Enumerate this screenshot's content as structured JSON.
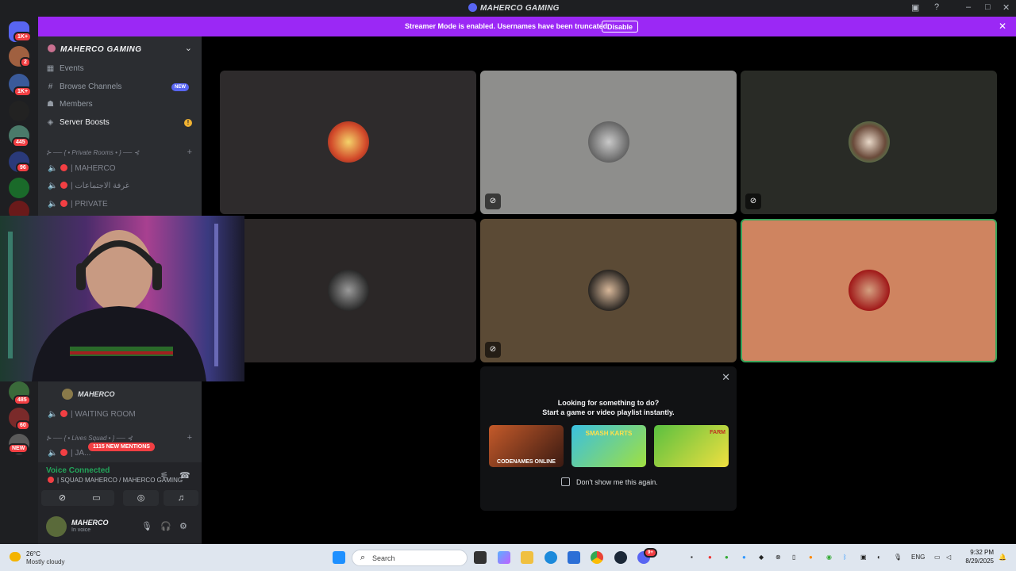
{
  "window": {
    "title": "MAHERCO GAMING"
  },
  "banner": {
    "message": "Streamer Mode is enabled. Usernames have been truncated.",
    "button": "Disable",
    "bg": "#9b28f5"
  },
  "rail": {
    "badges": [
      "1K+",
      "2",
      "1K+",
      "445",
      "96",
      "485",
      "60",
      "NEW"
    ]
  },
  "sidebar": {
    "server_name": "MAHERCO GAMING",
    "nav": [
      {
        "label": "Events",
        "icon": "calendar-icon"
      },
      {
        "label": "Browse Channels",
        "icon": "browse-channels-icon",
        "badge": "NEW"
      },
      {
        "label": "Members",
        "icon": "members-icon"
      },
      {
        "label": "Server Boosts",
        "icon": "boost-icon"
      }
    ],
    "categories": {
      "private": "⊱ ── { • Private Rooms • } ── ⊰",
      "lives": "⊱ ── { • Lives Squad • } ── ⊰"
    },
    "voice_channels": [
      "| MAHERCO",
      "| غرفة الاجتماعات",
      "| PRIVATE",
      "| WAITING ROOM",
      "| JA..."
    ],
    "member": "MAHERCO",
    "mentions": "1115 NEW MENTIONS"
  },
  "voice": {
    "status": "Voice Connected",
    "channel": "| SQUAD MAHERCO / MAHERCO GAMING",
    "user": "MAHERCO",
    "user_status": "In voice"
  },
  "popup": {
    "line1": "Looking for something to do?",
    "line2": "Start a game or video playlist instantly.",
    "games": [
      "CODENAMES ONLINE",
      "SMASH KARTS",
      "FARM"
    ],
    "checkbox_label": "Don't show me this again."
  },
  "taskbar": {
    "temp": "26°C",
    "weather": "Mostly cloudy",
    "search_placeholder": "Search",
    "lang": "ENG",
    "time": "9:32 PM",
    "date": "8/29/2025",
    "discord_badge": "9+"
  },
  "colors": {
    "accent": "#5865f2",
    "danger": "#f23f43",
    "success": "#23a55a",
    "speaking": "#3ba55c"
  }
}
